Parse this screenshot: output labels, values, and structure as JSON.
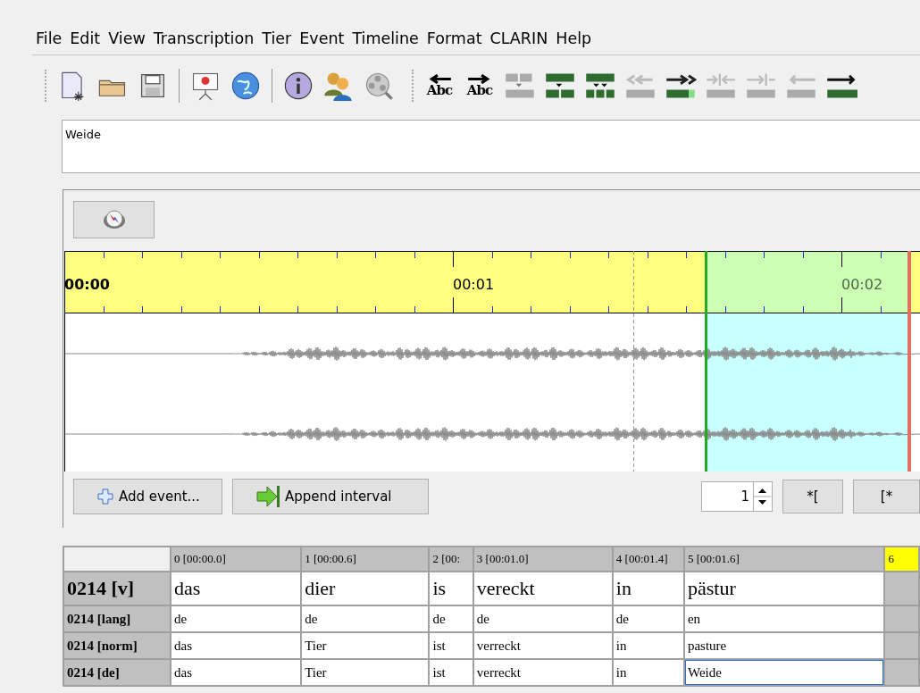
{
  "menu": [
    "File",
    "Edit",
    "View",
    "Transcription",
    "Tier",
    "Event",
    "Timeline",
    "Format",
    "CLARIN",
    "Help"
  ],
  "toolbar": {
    "text_buttons": [
      "Abc",
      "Abc"
    ]
  },
  "editor": {
    "value": "Weide"
  },
  "timeline": {
    "labels": [
      {
        "text": "00:00",
        "bold": true
      },
      {
        "text": "00:01",
        "bold": false
      },
      {
        "text": "00:02",
        "bold": false
      }
    ]
  },
  "buttons": {
    "add_event": "Add event...",
    "append_interval": "Append interval",
    "spinner": "1",
    "start_mark": "*[",
    "end_mark": "[*"
  },
  "table": {
    "columns": [
      {
        "label": "0 [00:00.0]",
        "selected": false
      },
      {
        "label": "1 [00:00.6]",
        "selected": false
      },
      {
        "label": "2 [00:",
        "selected": false
      },
      {
        "label": "3 [00:01.0]",
        "selected": false
      },
      {
        "label": "4 [00:01.4]",
        "selected": false
      },
      {
        "label": "5 [00:01.6]",
        "selected": false
      },
      {
        "label": "6",
        "selected": true
      }
    ],
    "rows": [
      {
        "tier": "0214 [v]",
        "kind": "large",
        "cells": [
          {
            "text": "das",
            "selected": false
          },
          {
            "text": "dier",
            "selected": false
          },
          {
            "text": "is",
            "selected": false
          },
          {
            "text": "vereckt",
            "selected": false
          },
          {
            "text": "in",
            "selected": false
          },
          {
            "text": "pästur",
            "selected": false
          }
        ]
      },
      {
        "tier": "0214 [lang]",
        "kind": "small",
        "cells": [
          {
            "text": "de",
            "selected": false
          },
          {
            "text": "de",
            "selected": false
          },
          {
            "text": "de",
            "selected": false
          },
          {
            "text": "de",
            "selected": false
          },
          {
            "text": "de",
            "selected": false
          },
          {
            "text": "en",
            "selected": false
          }
        ]
      },
      {
        "tier": "0214 [norm]",
        "kind": "small",
        "cells": [
          {
            "text": "das",
            "selected": false
          },
          {
            "text": "Tier",
            "selected": false
          },
          {
            "text": "ist",
            "selected": false
          },
          {
            "text": "verreckt",
            "selected": false
          },
          {
            "text": "in",
            "selected": false
          },
          {
            "text": "pasture",
            "selected": false
          }
        ]
      },
      {
        "tier": "0214 [de]",
        "kind": "small",
        "cells": [
          {
            "text": "das",
            "selected": false
          },
          {
            "text": "Tier",
            "selected": false
          },
          {
            "text": "ist",
            "selected": false
          },
          {
            "text": "verreckt",
            "selected": false
          },
          {
            "text": "in",
            "selected": false
          },
          {
            "text": "Weide",
            "selected": true
          }
        ]
      }
    ]
  }
}
